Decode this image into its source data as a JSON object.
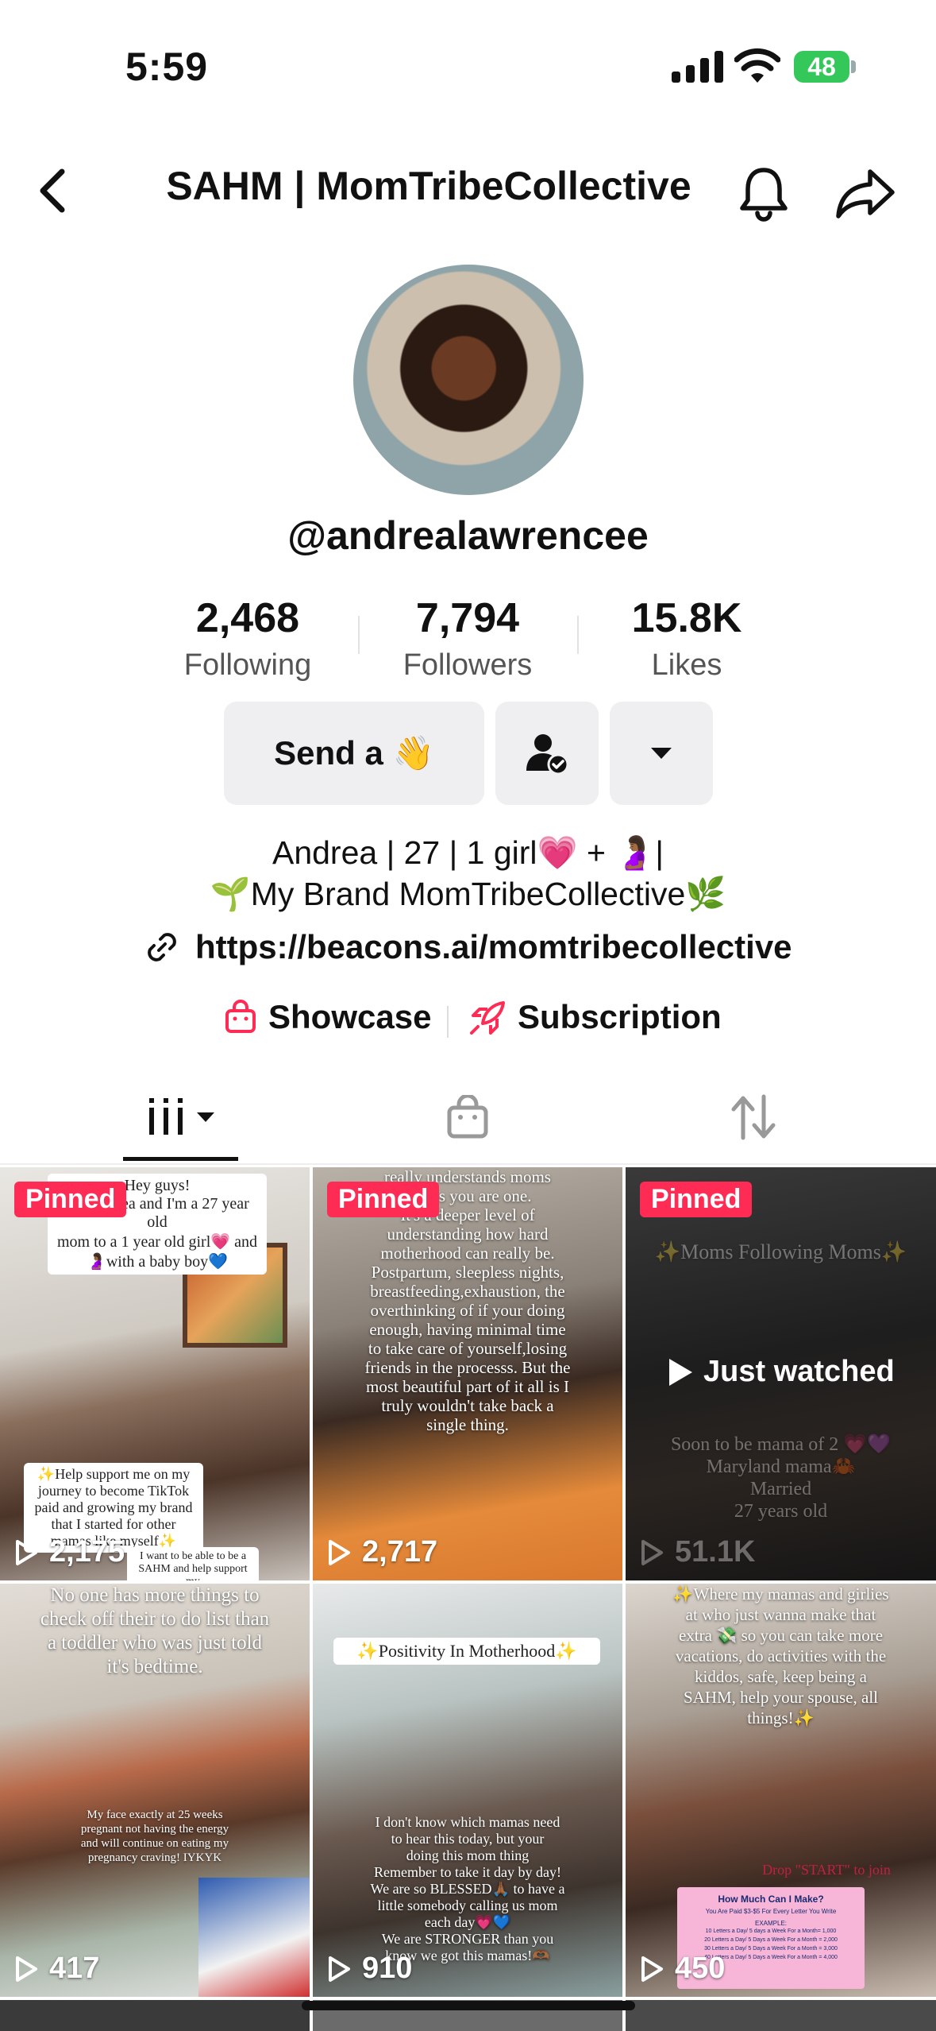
{
  "status_bar": {
    "time": "5:59",
    "battery": "48"
  },
  "header": {
    "title": "SAHM | MomTribeCollective"
  },
  "profile": {
    "username": "@andrealawrencee",
    "stats": [
      {
        "value": "2,468",
        "label": "Following"
      },
      {
        "value": "7,794",
        "label": "Followers"
      },
      {
        "value": "15.8K",
        "label": "Likes"
      }
    ],
    "send_button": "Send a 👋",
    "bio_line1": "Andrea | 27 | 1 girl💗 + 🤰🏾|",
    "bio_line2": "🌱My Brand MomTribeCollective🌿",
    "link": "https://beacons.ai/momtribecollective",
    "showcase": "Showcase",
    "subscription": "Subscription"
  },
  "videos": [
    {
      "pinned": "Pinned",
      "views": "2,175",
      "caption_top": "Hey guys!\nI'm Andrea and I'm a 27 year old\nmom to a 1 year old girl💗 and\n🤰🏾with a baby boy💙",
      "caption_box": "✨Help support me on my journey to become TikTok paid and growing my brand that I started for other mamas like myself✨",
      "caption_bottom": "I want to be able to be a SAHM and help support my"
    },
    {
      "pinned": "Pinned",
      "views": "2,717",
      "caption_top": "really understands moms\nunless you are one.\nIt's a deeper level of\nunderstanding how hard\nmotherhood can really be.\nPostpartum, sleepless nights,\nbreastfeeding,exhaustion, the\noverthinking of if your doing\nenough, having minimal time\nto take care of yourself,losing\nfriends in the processs. But the\nmost beautiful part of it all is I\ntruly wouldn't take back a\nsingle thing."
    },
    {
      "pinned": "Pinned",
      "views": "51.1K",
      "overlay": "Just watched",
      "caption_top": "✨Moms Following Moms✨",
      "caption_bottom": "Soon to be mama of 2 💗💜\nMaryland mama🦀\nMarried\n27 years old"
    },
    {
      "views": "417",
      "caption_top": "No one has more things to\ncheck off their to do list than\na toddler who was just told\nit's bedtime.",
      "caption_bottom": "My face exactly at 25 weeks\npregnant not having the energy\nand will continue on eating my\npregnancy craving! IYKYK"
    },
    {
      "views": "910",
      "caption_box": "✨Positivity In Motherhood✨",
      "caption_bottom": "I don't know which mamas need\nto hear this today, but your\ndoing this mom thing\nRemember to take it day by day!\nWe are so BLESSED🙏🏾 to have a\nlittle somebody calling us mom\neach day💗💙\nWe are STRONGER than you\nknow we got this mamas!🫶🏾"
    },
    {
      "views": "450",
      "caption_top": "✨Where my mamas and girlies\nat who just wanna make that\nextra 💸 so you can take more\nvacations, do activities with the\nkiddos, safe, keep being a\nSAHM, help your spouse, all\nthings!✨",
      "caption_side": "Drop \"START\" to join",
      "card_title": "How Much Can I Make?",
      "card_sub": "You Are Paid $3-$5 For Every Letter You Write",
      "card_example": "EXAMPLE:",
      "card_lines": "10 Letters a Day/ 5 days a Week For a Month= 1,000\n20 Letters a Day/ 5 Days a Week For a Month = 2,000\n30 Letters a Day/ 5 Days a Week For a Month = 3,000\n40 Letters a Day/ 5 Days a Week For a Month = 4,000"
    }
  ],
  "colors": {
    "accent": "#fe2c55",
    "button_bg": "#efeff1",
    "battery": "#34c759"
  }
}
